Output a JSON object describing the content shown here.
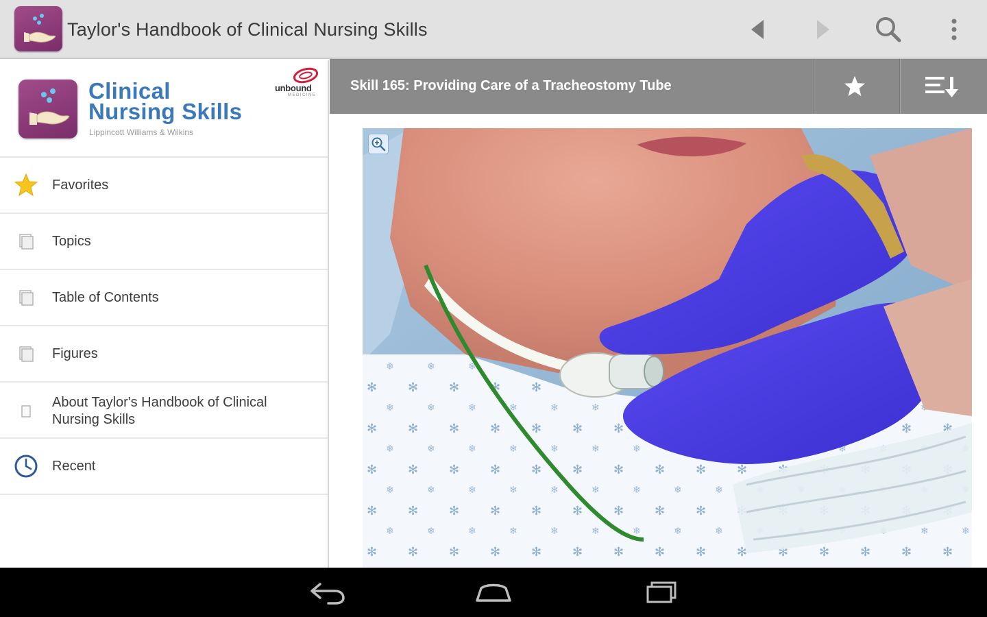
{
  "app": {
    "title": "Taylor's Handbook of Clinical Nursing Skills",
    "icon": "hand-with-drops-icon",
    "accent": "#8a3a78"
  },
  "toolbar": {
    "back_icon": "arrow-left-icon",
    "forward_icon": "arrow-right-icon",
    "search_icon": "search-icon",
    "more_icon": "overflow-menu-icon"
  },
  "drawer": {
    "brand": {
      "line1": "Clinical",
      "line2": "Nursing Skills",
      "publisher": "Lippincott Williams & Wilkins",
      "logo_text": "unbound",
      "logo_sub": "MEDICINE"
    },
    "items": [
      {
        "label": "Favorites",
        "icon": "star-icon"
      },
      {
        "label": "Topics",
        "icon": "pages-icon"
      },
      {
        "label": "Table of Contents",
        "icon": "pages-icon"
      },
      {
        "label": "Figures",
        "icon": "pages-icon"
      },
      {
        "label": "About Taylor's Handbook of Clinical Nursing Skills",
        "icon": "page-icon"
      },
      {
        "label": "Recent",
        "icon": "clock-icon"
      }
    ]
  },
  "content": {
    "title": "Skill 165: Providing Care of a Tracheostomy Tube",
    "favorite_icon": "star-icon",
    "sort_icon": "sort-icon",
    "figure": {
      "zoom_icon": "zoom-in-icon"
    }
  },
  "system_nav": {
    "back": "back-icon",
    "home": "home-icon",
    "recents": "recents-icon"
  },
  "colors": {
    "toolbar_bg": "#e2e2e2",
    "header_bg": "#8a8a8a",
    "brand_blue": "#3b79b8",
    "nav_bg": "#000000"
  }
}
